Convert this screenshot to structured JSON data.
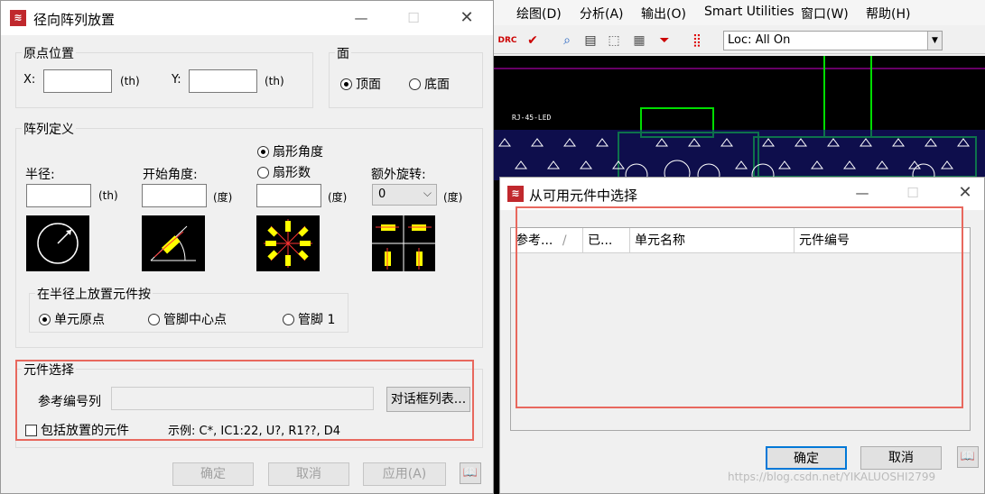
{
  "background_app": {
    "menu": [
      "绘图(D)",
      "分析(A)",
      "输出(O)",
      "Smart Utilities",
      "窗口(W)",
      "帮助(H)"
    ],
    "loc_select": "Loc: All On",
    "pcb_label": "RJ-45-LED"
  },
  "radial_dialog": {
    "title": "径向阵列放置",
    "origin_group": {
      "label": "原点位置",
      "x_label": "X:",
      "x_value": "",
      "x_unit": "(th)",
      "y_label": "Y:",
      "y_value": "",
      "y_unit": "(th)"
    },
    "side_group": {
      "label": "面",
      "options": [
        "顶面",
        "底面"
      ],
      "selected": "顶面"
    },
    "array_group": {
      "label": "阵列定义",
      "radius_label": "半径:",
      "radius_value": "",
      "radius_unit": "(th)",
      "start_angle_label": "开始角度:",
      "start_angle_value": "",
      "start_angle_unit": "(度)",
      "sector_options": [
        "扇形角度",
        "扇形数"
      ],
      "sector_selected": "扇形角度",
      "sector_value": "",
      "sector_unit": "(度)",
      "extra_rotation_label": "额外旋转:",
      "extra_rotation_value": "0",
      "extra_rotation_unit": "(度)",
      "place_by_group": {
        "label": "在半径上放置元件按",
        "options": [
          "单元原点",
          "管脚中心点",
          "管脚 1"
        ],
        "selected": "单元原点"
      }
    },
    "component_group": {
      "label": "元件选择",
      "ref_label": "参考编号列",
      "ref_value": "",
      "dialog_list_button": "对话框列表...",
      "include_placed_label": "包括放置的元件",
      "include_placed_checked": false,
      "example_text": "示例: C*, IC1:22, U?, R1??, D4"
    },
    "buttons": {
      "ok": "确定",
      "cancel": "取消",
      "apply": "应用(A)"
    }
  },
  "select_dialog": {
    "title": "从可用元件中选择",
    "columns": [
      "参考...",
      "已...",
      "单元名称",
      "元件编号"
    ],
    "rows": [],
    "buttons": {
      "ok": "确定",
      "cancel": "取消"
    }
  },
  "watermark": "https://blog.csdn.net/YIKALUOSHI2799"
}
